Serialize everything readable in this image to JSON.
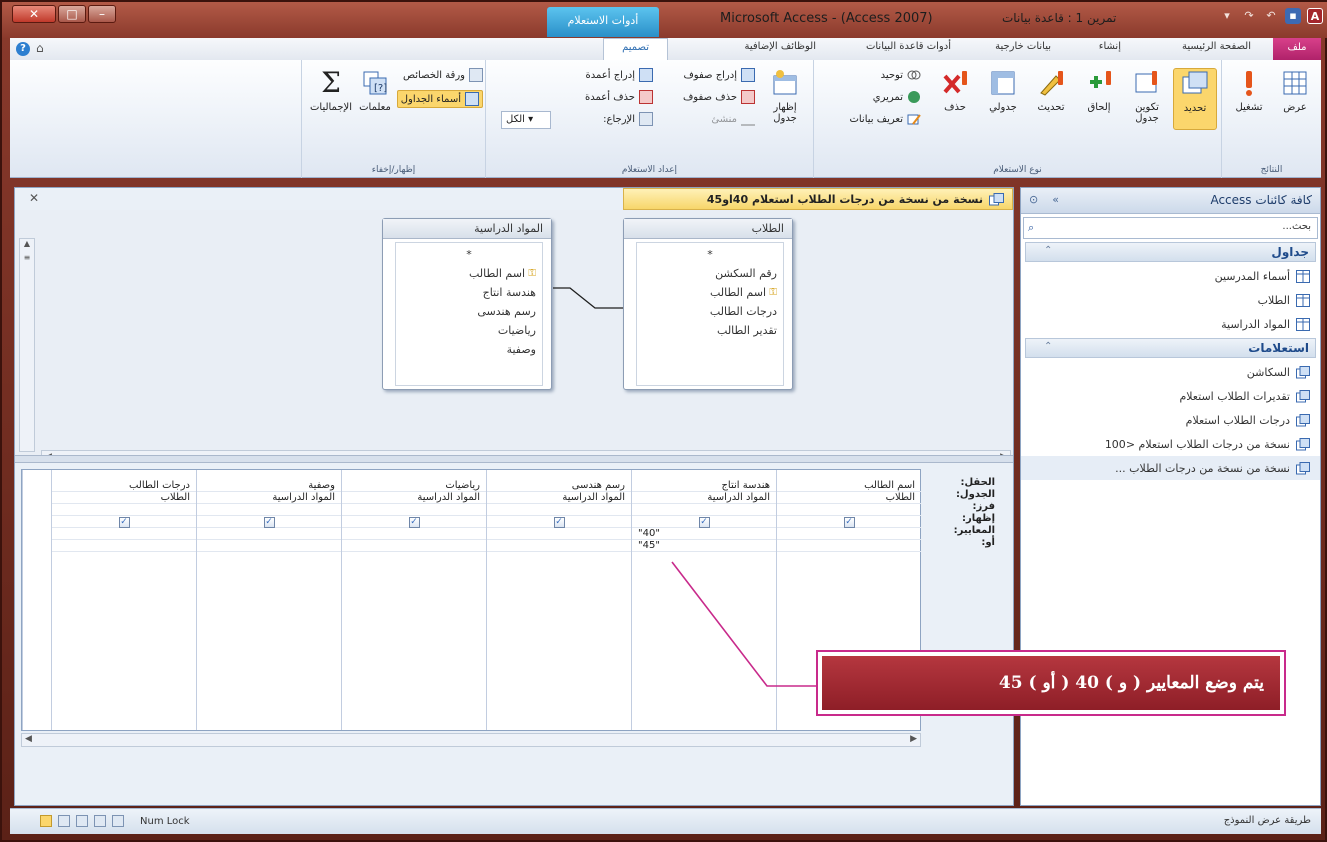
{
  "window": {
    "title": "Microsoft Access - (Access 2007)",
    "title_db": "تمرين 1 : قاعدة بيانات",
    "context_tab": "أدوات الاستعلام"
  },
  "tabs": {
    "file": "ملف",
    "home": "الصفحة الرئيسية",
    "create": "إنشاء",
    "external": "بيانات خارجية",
    "dbtools": "أدوات قاعدة البيانات",
    "addins": "الوظائف الإضافية",
    "design": "تصميم"
  },
  "ribbon": {
    "results": {
      "label": "النتائج",
      "view": "عرض",
      "run": "تشغيل"
    },
    "query_type": {
      "label": "نوع الاستعلام",
      "select": "تحديد",
      "make_table": "تكوين جدول",
      "append": "إلحاق",
      "update": "تحديث",
      "crosstab": "جدولي",
      "delete": "حذف",
      "union": "توحيد",
      "passthrough": "تمريري",
      "data_definition": "تعريف بيانات"
    },
    "query_setup": {
      "label": "إعداد الاستعلام",
      "show_table": "إظهار جدول",
      "insert_rows": "إدراج صفوف",
      "delete_rows": "حذف صفوف",
      "builder": "منشئ",
      "insert_columns": "إدراج أعمدة",
      "delete_columns": "حذف أعمدة",
      "return": "الإرجاع:",
      "return_value": "الكل"
    },
    "show_hide": {
      "label": "إظهار/إخفاء",
      "totals": "الإجماليات",
      "parameters": "معلمات",
      "property_sheet": "ورقة الخصائص",
      "table_names": "أسماء الجداول"
    }
  },
  "nav": {
    "title": "كافة كائنات Access",
    "search_placeholder": "بحث...",
    "groups": [
      {
        "label": "جداول",
        "items": [
          "أسماء المدرسين",
          "الطلاب",
          "المواد الدراسية"
        ]
      },
      {
        "label": "استعلامات",
        "items": [
          "السكاشن",
          "تقديرات الطلاب استعلام",
          "درجات الطلاب استعلام",
          "نسخة من درجات الطلاب استعلام <100",
          "نسخة من نسخة من درجات الطلاب ..."
        ]
      }
    ]
  },
  "query": {
    "tab_title": "نسخة من نسخة من درجات الطلاب استعلام 40او45",
    "tables": [
      {
        "name": "الطلاب",
        "fields": [
          "*",
          "رقم السكشن",
          "اسم الطالب",
          "درجات الطالب",
          "تقدير الطالب"
        ],
        "key_index": 2
      },
      {
        "name": "المواد الدراسية",
        "fields": [
          "*",
          "اسم الطالب",
          "هندسة انتاج",
          "رسم هندسى",
          "رياضيات",
          "وصفية"
        ],
        "key_index": 1
      }
    ],
    "row_labels": [
      "الحقل:",
      "الجدول:",
      "فرز:",
      "إظهار:",
      "المعايير:",
      "أو:"
    ],
    "columns": [
      {
        "field": "اسم الطالب",
        "table": "الطلاب",
        "show": true,
        "criteria": "",
        "or": ""
      },
      {
        "field": "هندسة انتاج",
        "table": "المواد الدراسية",
        "show": true,
        "criteria": "\"40\"",
        "or": "\"45\""
      },
      {
        "field": "رسم هندسى",
        "table": "المواد الدراسية",
        "show": true,
        "criteria": "",
        "or": ""
      },
      {
        "field": "رياضيات",
        "table": "المواد الدراسية",
        "show": true,
        "criteria": "",
        "or": ""
      },
      {
        "field": "وصفية",
        "table": "المواد الدراسية",
        "show": true,
        "criteria": "",
        "or": ""
      },
      {
        "field": "درجات الطالب",
        "table": "الطلاب",
        "show": true,
        "criteria": "",
        "or": ""
      }
    ]
  },
  "callout": {
    "text": "يتم وضع المعايير ( و ) 40 ( أو ) 45"
  },
  "status": {
    "left": "Num Lock",
    "right": "طريقة عرض النموذج"
  },
  "colors": {
    "accent": "#c82a8b",
    "callout_fill": "#9e2830",
    "selected": "#fbd66c"
  }
}
